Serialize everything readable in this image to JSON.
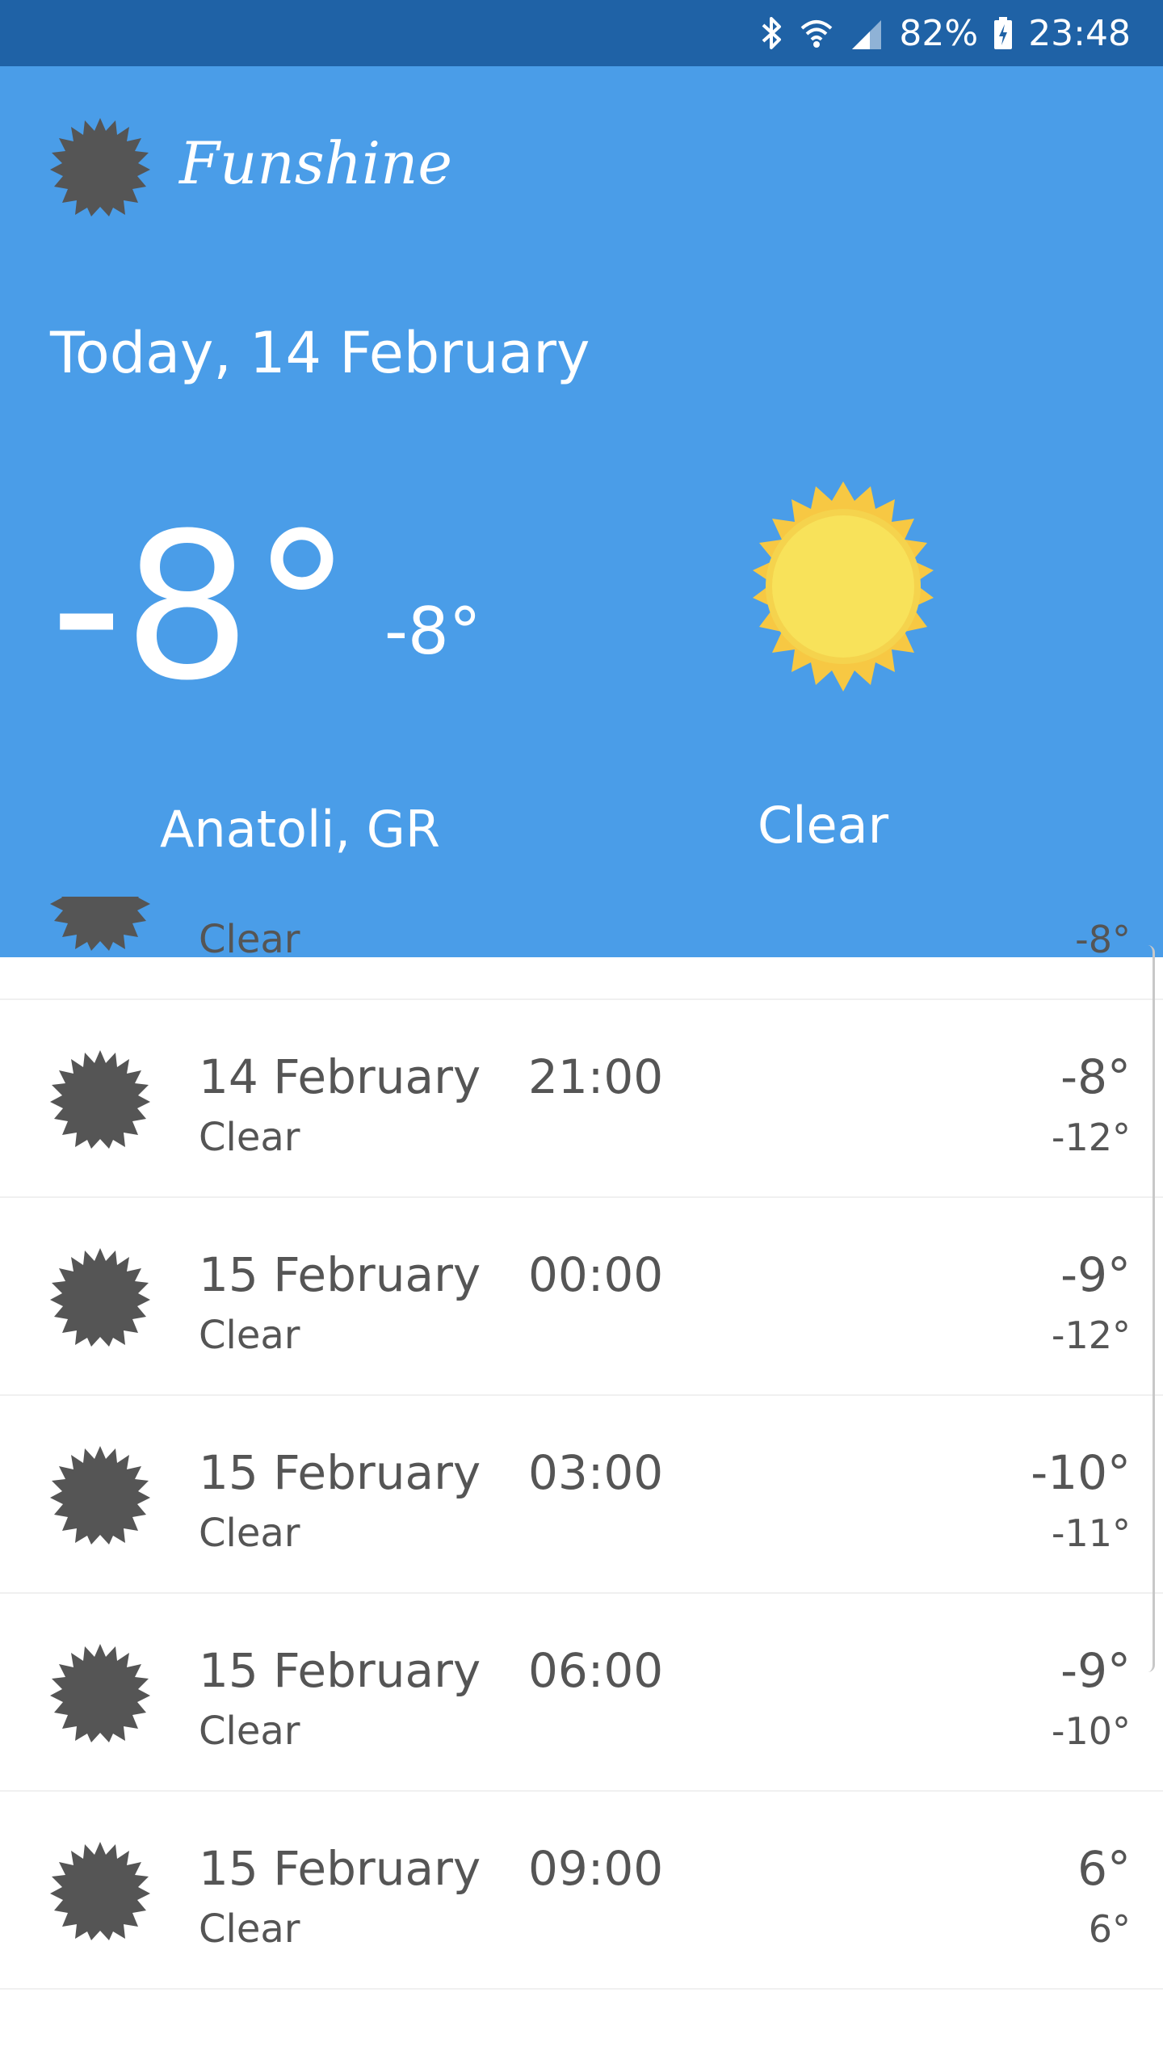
{
  "status_bar": {
    "battery": "82%",
    "time": "23:48",
    "icons": [
      "bluetooth-icon",
      "wifi-icon",
      "signal-icon",
      "battery-charging-icon"
    ]
  },
  "header": {
    "app_name": "Funshine",
    "date": "Today, 14 February",
    "temp": "-8°",
    "feels_like": "-8°",
    "location": "Anatoli, GR",
    "condition": "Clear",
    "colors": {
      "background": "#4a9de8",
      "status_bar": "#1f62a6",
      "sun": "#f7d84a"
    }
  },
  "forecast": [
    {
      "date": "",
      "time": "",
      "condition": "Clear",
      "high": "",
      "low": "-8°"
    },
    {
      "date": "14 February",
      "time": "21:00",
      "condition": "Clear",
      "high": "-8°",
      "low": "-12°"
    },
    {
      "date": "15 February",
      "time": "00:00",
      "condition": "Clear",
      "high": "-9°",
      "low": "-12°"
    },
    {
      "date": "15 February",
      "time": "03:00",
      "condition": "Clear",
      "high": "-10°",
      "low": "-11°"
    },
    {
      "date": "15 February",
      "time": "06:00",
      "condition": "Clear",
      "high": "-9°",
      "low": "-10°"
    },
    {
      "date": "15 February",
      "time": "09:00",
      "condition": "Clear",
      "high": "6°",
      "low": "6°"
    }
  ]
}
